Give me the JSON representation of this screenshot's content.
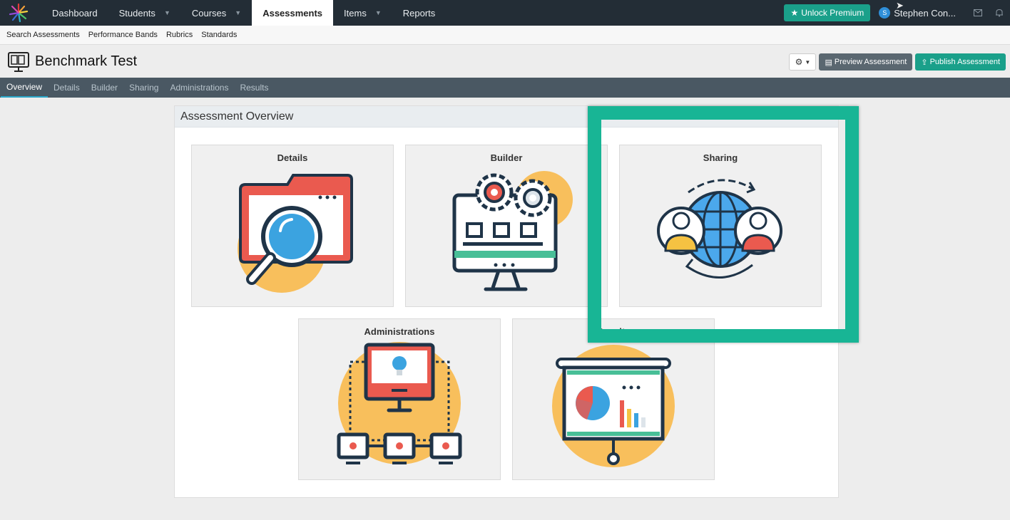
{
  "nav": {
    "items": [
      {
        "label": "Dashboard",
        "caret": false
      },
      {
        "label": "Students",
        "caret": true
      },
      {
        "label": "Courses",
        "caret": true
      },
      {
        "label": "Assessments",
        "caret": false,
        "active": true
      },
      {
        "label": "Items",
        "caret": true
      },
      {
        "label": "Reports",
        "caret": false
      }
    ],
    "premium_label": "Unlock Premium",
    "user_initial": "S",
    "user_name": "Stephen Con..."
  },
  "subnav": [
    "Search Assessments",
    "Performance Bands",
    "Rubrics",
    "Standards"
  ],
  "header": {
    "title": "Benchmark Test",
    "preview_label": "Preview Assessment",
    "publish_label": "Publish Assessment"
  },
  "tabs": [
    "Overview",
    "Details",
    "Builder",
    "Sharing",
    "Administrations",
    "Results"
  ],
  "panel": {
    "title": "Assessment Overview",
    "cards": {
      "details": "Details",
      "builder": "Builder",
      "sharing": "Sharing",
      "administrations": "Administrations",
      "results": "Results"
    }
  },
  "colors": {
    "topnav": "#232d36",
    "accent": "#1aa08a",
    "tabbar": "#4a5863",
    "highlight": "#18b595"
  }
}
